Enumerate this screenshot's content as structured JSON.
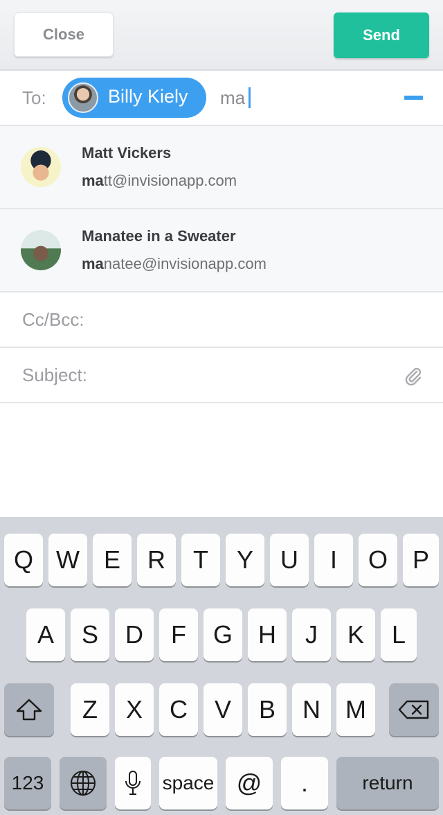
{
  "header": {
    "close_label": "Close",
    "send_label": "Send",
    "colors": {
      "send": "#20c09c",
      "accent": "#3d9ff0"
    }
  },
  "to": {
    "label": "To:",
    "recipient_chip": "Billy Kiely",
    "typed_value": "ma"
  },
  "suggestions": [
    {
      "name": "Matt Vickers",
      "email_match": "ma",
      "email_rest": "tt@invisionapp.com",
      "avatar": "matt-avatar"
    },
    {
      "name": "Manatee in a Sweater",
      "email_match": "ma",
      "email_rest": "natee@invisionapp.com",
      "avatar": "manatee-avatar"
    }
  ],
  "cc": {
    "label": "Cc/Bcc:"
  },
  "subject": {
    "label": "Subject:",
    "attach_icon": "paperclip-icon"
  },
  "keyboard": {
    "row1": [
      "Q",
      "W",
      "E",
      "R",
      "T",
      "Y",
      "U",
      "I",
      "O",
      "P"
    ],
    "row2": [
      "A",
      "S",
      "D",
      "F",
      "G",
      "H",
      "J",
      "K",
      "L"
    ],
    "row3": [
      "Z",
      "X",
      "C",
      "V",
      "B",
      "N",
      "M"
    ],
    "num_label": "123",
    "space_label": "space",
    "at_label": "@",
    "period_label": ".",
    "return_label": "return"
  }
}
